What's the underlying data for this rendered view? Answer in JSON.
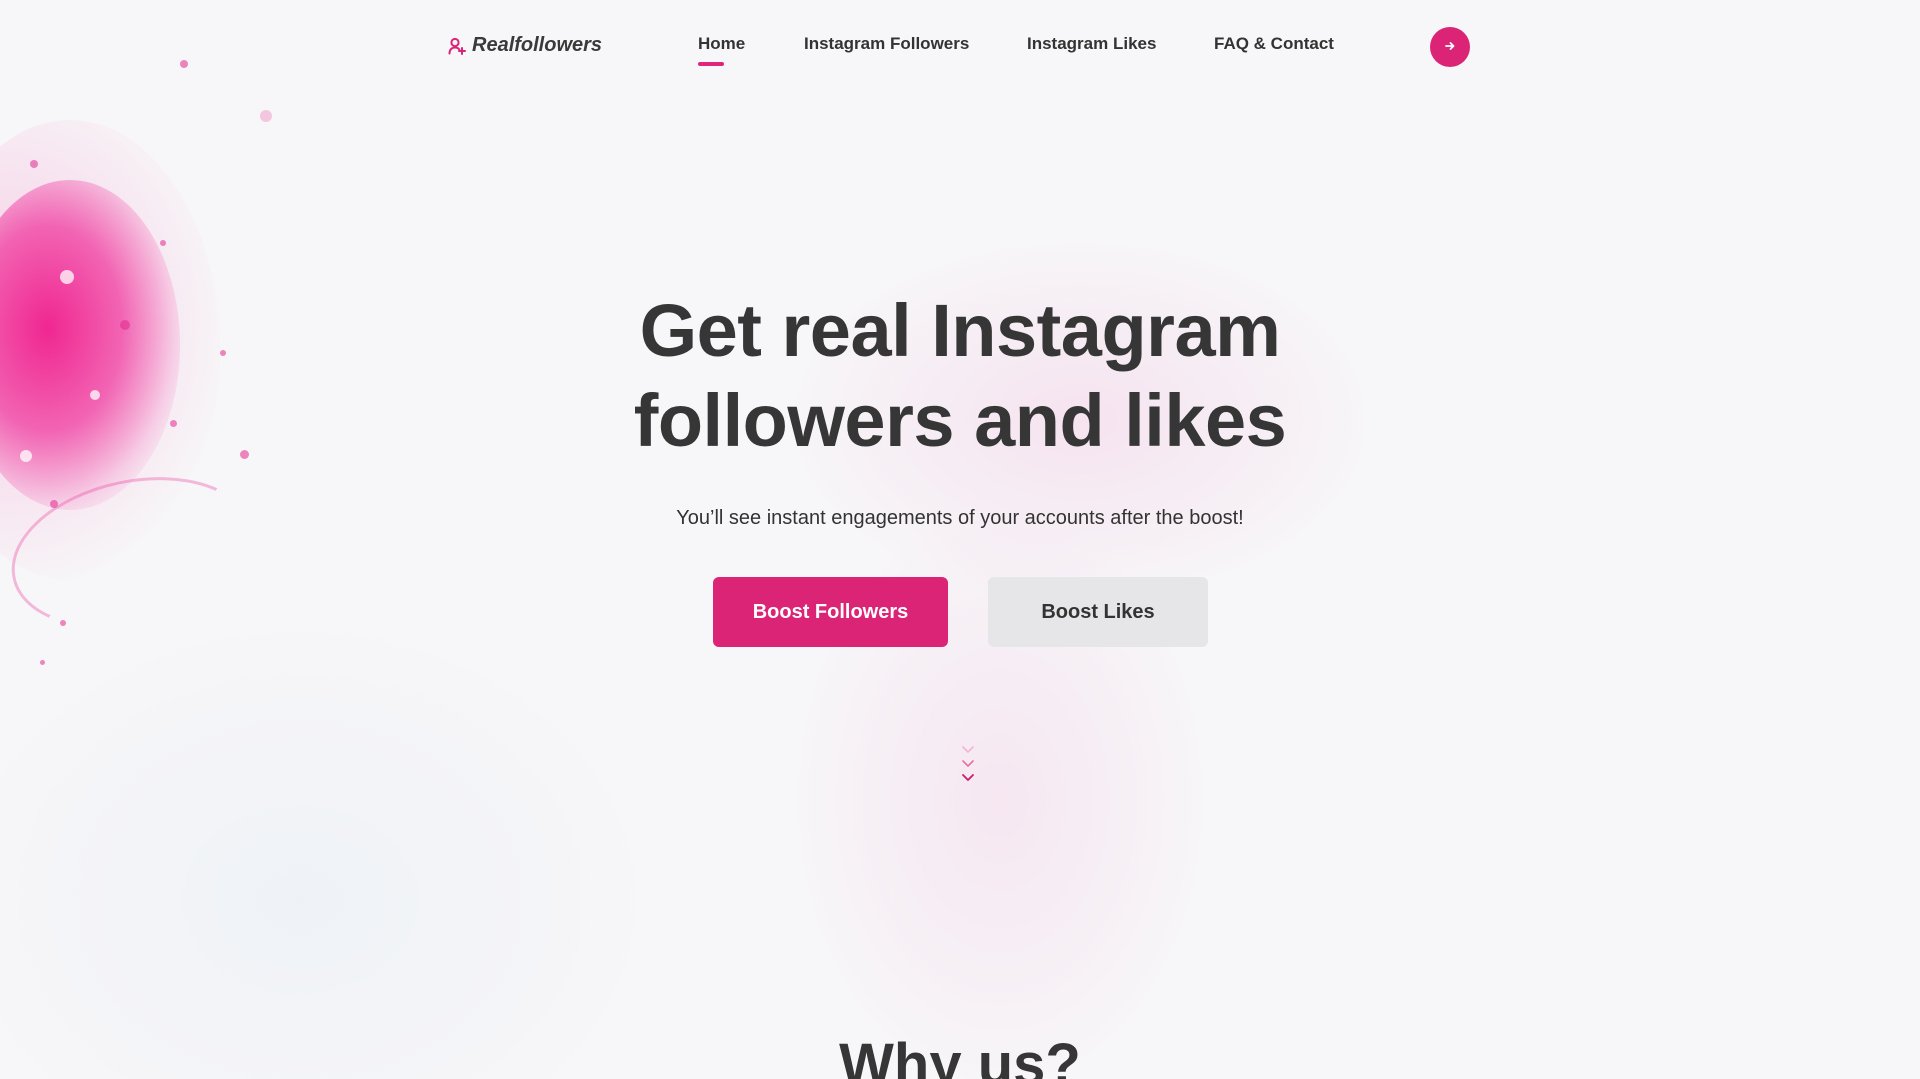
{
  "brand": {
    "name": "Realfollowers",
    "icon": "user-plus-icon",
    "accent_color": "#dc2477"
  },
  "nav": {
    "items": [
      {
        "label": "Home",
        "active": true
      },
      {
        "label": "Instagram Followers",
        "active": false
      },
      {
        "label": "Instagram Likes",
        "active": false
      },
      {
        "label": "FAQ & Contact",
        "active": false
      }
    ],
    "login_icon": "arrow-right-icon"
  },
  "hero": {
    "title_line1": "Get real Instagram",
    "title_line2": "followers and likes",
    "subtitle": "You’ll see instant engagements of your accounts after the boost!",
    "primary_button": "Boost Followers",
    "secondary_button": "Boost Likes",
    "scroll_icon": "chevrons-down-icon"
  },
  "why": {
    "title": "Why us?"
  }
}
